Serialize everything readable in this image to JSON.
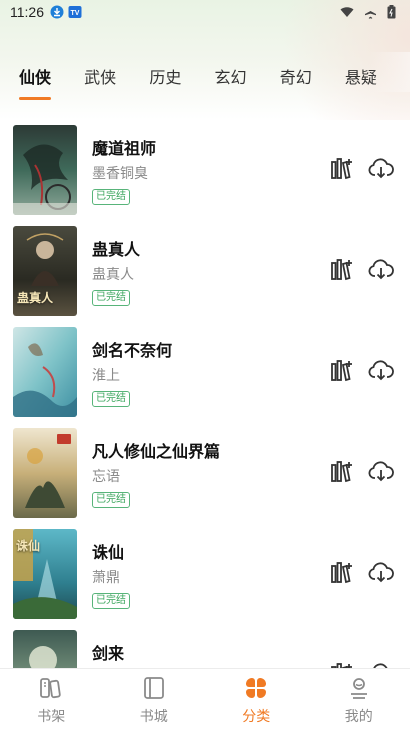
{
  "status_bar": {
    "time": "11:26"
  },
  "tabs": [
    {
      "label": "仙侠",
      "active": true
    },
    {
      "label": "武侠",
      "active": false
    },
    {
      "label": "历史",
      "active": false
    },
    {
      "label": "玄幻",
      "active": false
    },
    {
      "label": "奇幻",
      "active": false
    },
    {
      "label": "悬疑",
      "active": false
    }
  ],
  "books": [
    {
      "title": "魔道祖师",
      "author": "墨香铜臭",
      "status": "已完结"
    },
    {
      "title": "蛊真人",
      "author": "蛊真人",
      "status": "已完结",
      "cover_text": "蛊真人"
    },
    {
      "title": "剑名不奈何",
      "author": "淮上",
      "status": "已完结"
    },
    {
      "title": "凡人修仙之仙界篇",
      "author": "忘语",
      "status": "已完结"
    },
    {
      "title": "诛仙",
      "author": "萧鼎",
      "status": "已完结",
      "cover_text": "诛仙"
    },
    {
      "title": "剑来",
      "author": "",
      "status": ""
    }
  ],
  "bottom_nav": [
    {
      "label": "书架",
      "icon": "bookshelf-icon",
      "active": false
    },
    {
      "label": "书城",
      "icon": "book-city-icon",
      "active": false
    },
    {
      "label": "分类",
      "icon": "category-icon",
      "active": true
    },
    {
      "label": "我的",
      "icon": "profile-icon",
      "active": false
    }
  ],
  "colors": {
    "accent": "#f07a24",
    "finished_badge": "#3aa55c"
  }
}
